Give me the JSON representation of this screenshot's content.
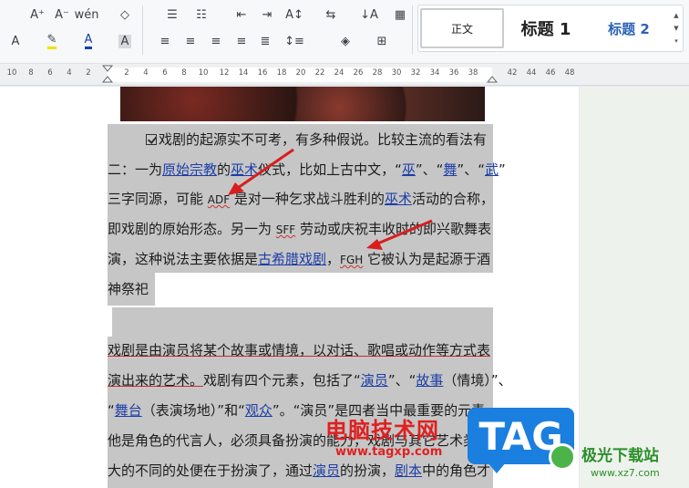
{
  "ribbon": {
    "row1": [
      {
        "name": "font-size-increase-button",
        "glyph": "A⁺"
      },
      {
        "name": "font-size-decrease-button",
        "glyph": "A⁻"
      },
      {
        "name": "phonetic-guide-button",
        "glyph": "wén"
      },
      {
        "name": "clear-format-button",
        "glyph": "◇"
      },
      {
        "name": "bullets-button",
        "glyph": "☰"
      },
      {
        "name": "numbering-button",
        "glyph": "☷"
      },
      {
        "name": "decrease-indent-button",
        "glyph": "⇤"
      },
      {
        "name": "increase-indent-button",
        "glyph": "⇥"
      },
      {
        "name": "text-direction-button",
        "glyph": "A↕"
      },
      {
        "name": "line-break-button",
        "glyph": "⇆"
      },
      {
        "name": "sort-button",
        "glyph": "↓A"
      },
      {
        "name": "show-marks-button",
        "glyph": "▦"
      }
    ],
    "row2": [
      {
        "name": "text-effect-button",
        "glyph": "A"
      },
      {
        "name": "highlight-button",
        "glyph": "✎"
      },
      {
        "name": "font-color-button",
        "glyph": "A"
      },
      {
        "name": "char-shading-button",
        "glyph": "A"
      },
      {
        "name": "align-left-button",
        "glyph": "≡"
      },
      {
        "name": "align-center-button",
        "glyph": "≡"
      },
      {
        "name": "align-right-button",
        "glyph": "≡"
      },
      {
        "name": "justify-button",
        "glyph": "≡"
      },
      {
        "name": "distributed-button",
        "glyph": "≣"
      },
      {
        "name": "line-spacing-button",
        "glyph": "↕≡"
      },
      {
        "name": "shading-button",
        "glyph": "◈"
      },
      {
        "name": "borders-button",
        "glyph": "⊞"
      }
    ],
    "styles": {
      "normal": "正文",
      "h1": "标题 1",
      "h2": "标题 2"
    }
  },
  "ruler": {
    "numbers": [
      "10",
      "8",
      "6",
      "4",
      "2",
      "2",
      "4",
      "6",
      "8",
      "10",
      "12",
      "14",
      "16",
      "18",
      "20",
      "22",
      "24",
      "26",
      "28",
      "30",
      "32",
      "34",
      "36",
      "38",
      "42",
      "44",
      "46",
      "48"
    ]
  },
  "document": {
    "lines": [
      {
        "segments": [
          {
            "t": "戏剧的起源实不可考，有多种假说。比较主流的看法有"
          }
        ]
      },
      {
        "segments": [
          {
            "t": "二：一为"
          },
          {
            "t": "原始宗教",
            "link": true
          },
          {
            "t": "的"
          },
          {
            "t": "巫术",
            "link": true
          },
          {
            "t": "仪式，比如上古中文，“"
          },
          {
            "t": "巫",
            "link": true
          },
          {
            "t": "”、“"
          },
          {
            "t": "舞",
            "link": true
          },
          {
            "t": "”、“"
          },
          {
            "t": "武",
            "link": true
          },
          {
            "t": "”"
          }
        ]
      },
      {
        "segments": [
          {
            "t": "三字同源，可能 "
          },
          {
            "t": "ADF",
            "latin": true
          },
          {
            "t": " 是对一种乞求战斗胜利的"
          },
          {
            "t": "巫术",
            "link": true
          },
          {
            "t": "活动的合称，"
          }
        ]
      },
      {
        "segments": [
          {
            "t": "即戏剧的原始形态。另一为 "
          },
          {
            "t": "SFF",
            "latin": true
          },
          {
            "t": " 劳动或庆祝丰收时的即兴歌舞表"
          }
        ]
      },
      {
        "segments": [
          {
            "t": "演，这种说法主要依据是"
          },
          {
            "t": "古希腊戏剧",
            "link": true
          },
          {
            "t": "，"
          },
          {
            "t": "FGH",
            "latin": true
          },
          {
            "t": " 它被认为是起源于酒"
          }
        ]
      },
      {
        "segments": [
          {
            "t": "神祭祀"
          }
        ]
      },
      {
        "segments": [
          {
            "t": "戏剧是由演员将某个故事或情境，以对话、歌唱或动作等方式表",
            "redline": true
          }
        ]
      },
      {
        "segments": [
          {
            "t": "演出来的艺术。",
            "redline": true
          },
          {
            "t": "戏剧有四个元素，包括了“"
          },
          {
            "t": "演员",
            "link": true
          },
          {
            "t": "”、“"
          },
          {
            "t": "故事",
            "link": true
          },
          {
            "t": "（情境）”、"
          }
        ]
      },
      {
        "segments": [
          {
            "t": "“"
          },
          {
            "t": "舞台",
            "link": true
          },
          {
            "t": "（表演场地）”和“"
          },
          {
            "t": "观众",
            "link": true
          },
          {
            "t": "”。“演员”是四者当中最重要的元素，"
          }
        ]
      },
      {
        "segments": [
          {
            "t": "他是角色的代言人，必须具备扮演的能力，戏剧与其它艺术类最"
          }
        ]
      },
      {
        "segments": [
          {
            "t": "大的不同的处便在于扮演了，通过"
          },
          {
            "t": "演员",
            "link": true
          },
          {
            "t": "的扮演，"
          },
          {
            "t": "剧本",
            "link": true
          },
          {
            "t": "中的角色才"
          }
        ]
      }
    ]
  },
  "watermark": {
    "cn": "电脑技术网",
    "url": "www.tagxp.com",
    "tag": "TAG",
    "logo_name": "极光下载站",
    "logo_url": "www.xz7.com"
  },
  "colors": {
    "link": "#1d3ea8",
    "selection": "#c6c6c6",
    "arrow": "#d81e1e",
    "tag_blue": "#1b7fe0"
  }
}
